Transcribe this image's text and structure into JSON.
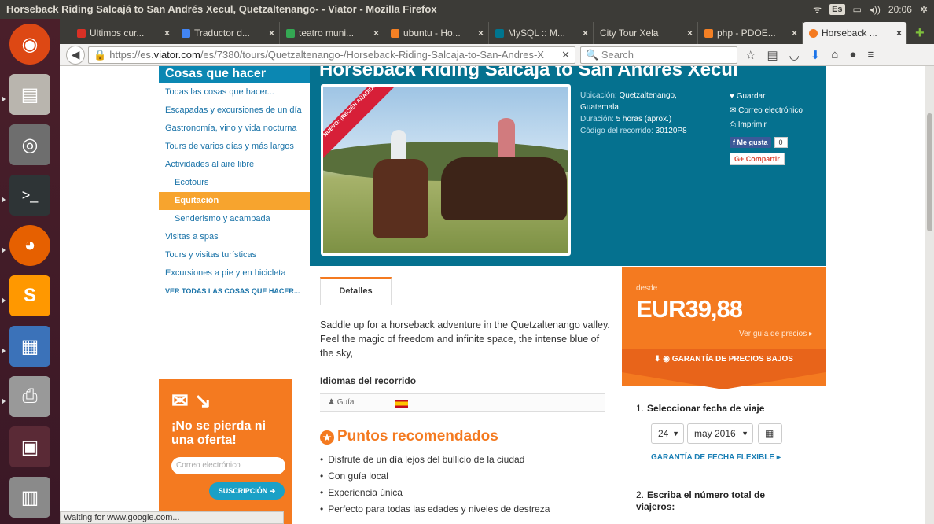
{
  "os": {
    "window_title": "Horseback Riding Salcajá to San Andrés Xecul, Quetzaltenango- - Viator - Mozilla Firefox",
    "keyboard": "Es",
    "volume": "◂))",
    "time": "20:06"
  },
  "tabs": [
    {
      "label": "Ultimos cur...",
      "color": "#d93025"
    },
    {
      "label": "Traductor d...",
      "color": "#4285f4"
    },
    {
      "label": "teatro muni...",
      "color": "#34a853"
    },
    {
      "label": "ubuntu - Ho...",
      "color": "#f48024"
    },
    {
      "label": "MySQL :: M...",
      "color": "#00758f"
    },
    {
      "label": "City Tour Xela",
      "color": "#888888"
    },
    {
      "label": "php - PDOE...",
      "color": "#f48024"
    },
    {
      "label": "Horseback ...",
      "color": "#f47a20"
    }
  ],
  "nav": {
    "url_prefix": "https://es.",
    "url_domain": "viator.com",
    "url_rest": "/es/7380/tours/Quetzaltenango-/Horseback-Riding-Salcaja-to-San-Andres-X",
    "search_placeholder": "Search"
  },
  "sidebar": {
    "title": "Cosas que hacer",
    "items": [
      {
        "label": "Todas las cosas que hacer..."
      },
      {
        "label": "Escapadas y excursiones de un día"
      },
      {
        "label": "Gastronomía, vino y vida nocturna"
      },
      {
        "label": "Tours de varios días y más largos"
      },
      {
        "label": "Actividades al aire libre"
      },
      {
        "label": "Ecotours"
      },
      {
        "label": "Equitación"
      },
      {
        "label": "Senderismo y acampada"
      },
      {
        "label": "Visitas a spas"
      },
      {
        "label": "Tours y visitas turísticas"
      },
      {
        "label": "Excursiones a pie y en bicicleta"
      },
      {
        "label": "VER TODAS LAS COSAS QUE HACER..."
      }
    ]
  },
  "newsletter": {
    "title": "¡No se pierda ni una oferta!",
    "email_placeholder": "Correo electrónico",
    "button": "SUSCRIPCIÓN ➔"
  },
  "hero": {
    "title": "Horseback Riding Salcajá to San Andrés Xecul",
    "ribbon": "NUEVO: ¡RECIÉN AÑADIDO!",
    "location_label": "Ubicación:",
    "location_value": "Quetzaltenango, Guatemala",
    "duration_label": "Duración:",
    "duration_value": "5 horas (aprox.)",
    "code_label": "Código del recorrido:",
    "code_value": "30120P8",
    "save": "Guardar",
    "email": "Correo electrónico",
    "print": "Imprimir",
    "like": "Me gusta",
    "like_count": "0",
    "share": "Compartir"
  },
  "details": {
    "tab": "Detalles",
    "description": "Saddle up for a horseback adventure in the Quetzaltenango valley. Feel the magic of freedom and infinite space, the intense blue of the sky,",
    "languages_heading": "Idiomas del recorrido",
    "guide_label": "Guía",
    "highlights_heading": "Puntos recomendados",
    "highlights": [
      "Disfrute de un día lejos del bullicio de la ciudad",
      "Con guía local",
      "Experiencia única",
      "Perfecto para todas las edades y niveles de destreza"
    ]
  },
  "price": {
    "from": "desde",
    "amount": "EUR39,88",
    "guide_link": "Ver guía de precios ▸",
    "guarantee": "GARANTÍA DE PRECIOS BAJOS"
  },
  "booking": {
    "step1_num": "1.",
    "step1_label": "Seleccionar fecha de viaje",
    "day": "24",
    "month": "may 2016",
    "flex": "GARANTÍA DE FECHA FLEXIBLE ▸",
    "step2_num": "2.",
    "step2_label": "Escriba el número total de viajeros:"
  },
  "status": "Waiting for www.google.com..."
}
